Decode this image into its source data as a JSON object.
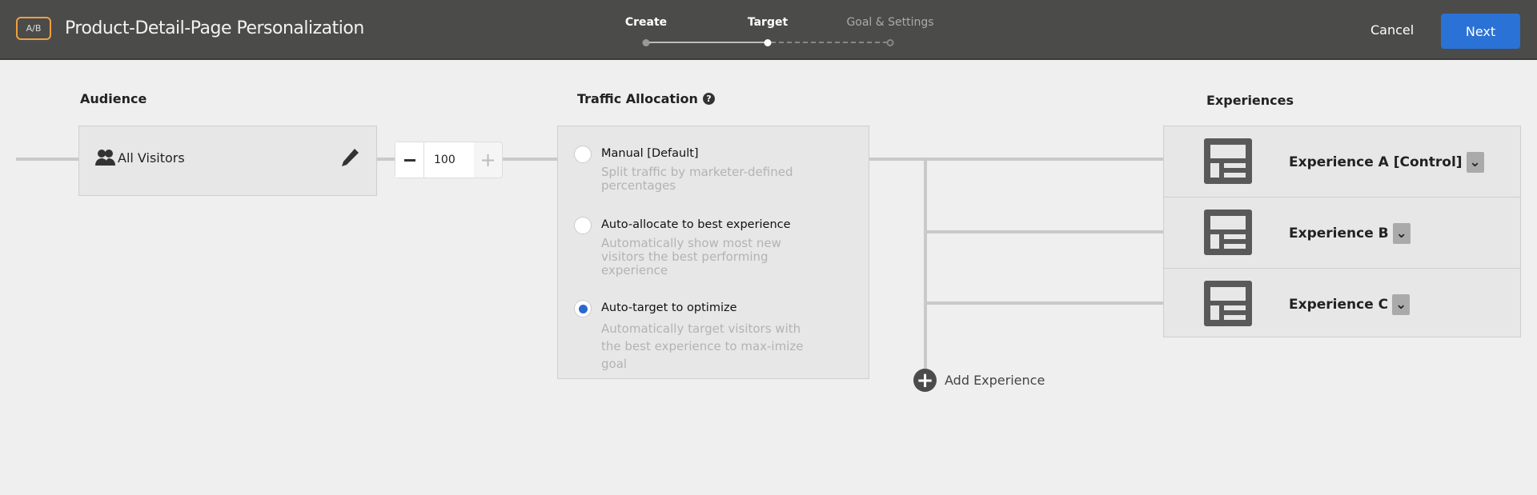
{
  "header": {
    "badge": "A/B",
    "title": "Product-Detail-Page Personalization",
    "steps": [
      {
        "label": "Create",
        "state": "done"
      },
      {
        "label": "Target",
        "state": "current"
      },
      {
        "label": "Goal & Settings",
        "state": "upcoming"
      }
    ],
    "cancel": "Cancel",
    "next": "Next"
  },
  "audience": {
    "heading": "Audience",
    "name": "All Visitors",
    "icon": "users-icon",
    "edit_icon": "pencil-icon",
    "percentage": "100"
  },
  "traffic": {
    "heading": "Traffic Allocation",
    "help_icon": "question-icon",
    "options": [
      {
        "label": "Manual [Default]",
        "desc": "Split traffic by marketer-defined percentages",
        "selected": false
      },
      {
        "label": "Auto-allocate to best experience",
        "desc": "Automatically show most new visitors the best performing experience",
        "selected": false
      },
      {
        "label": "Auto-target to optimize",
        "desc": "Automatically target visitors with the best experience to max-imize goal",
        "selected": true
      }
    ]
  },
  "experiences": {
    "heading": "Experiences",
    "items": [
      {
        "name": "Experience A [Control]"
      },
      {
        "name": "Experience B"
      },
      {
        "name": "Experience C"
      }
    ],
    "add_label": "Add Experience"
  },
  "colors": {
    "header": "#4b4b4a",
    "accent": "#2b72d6",
    "badge": "#f0a040"
  }
}
